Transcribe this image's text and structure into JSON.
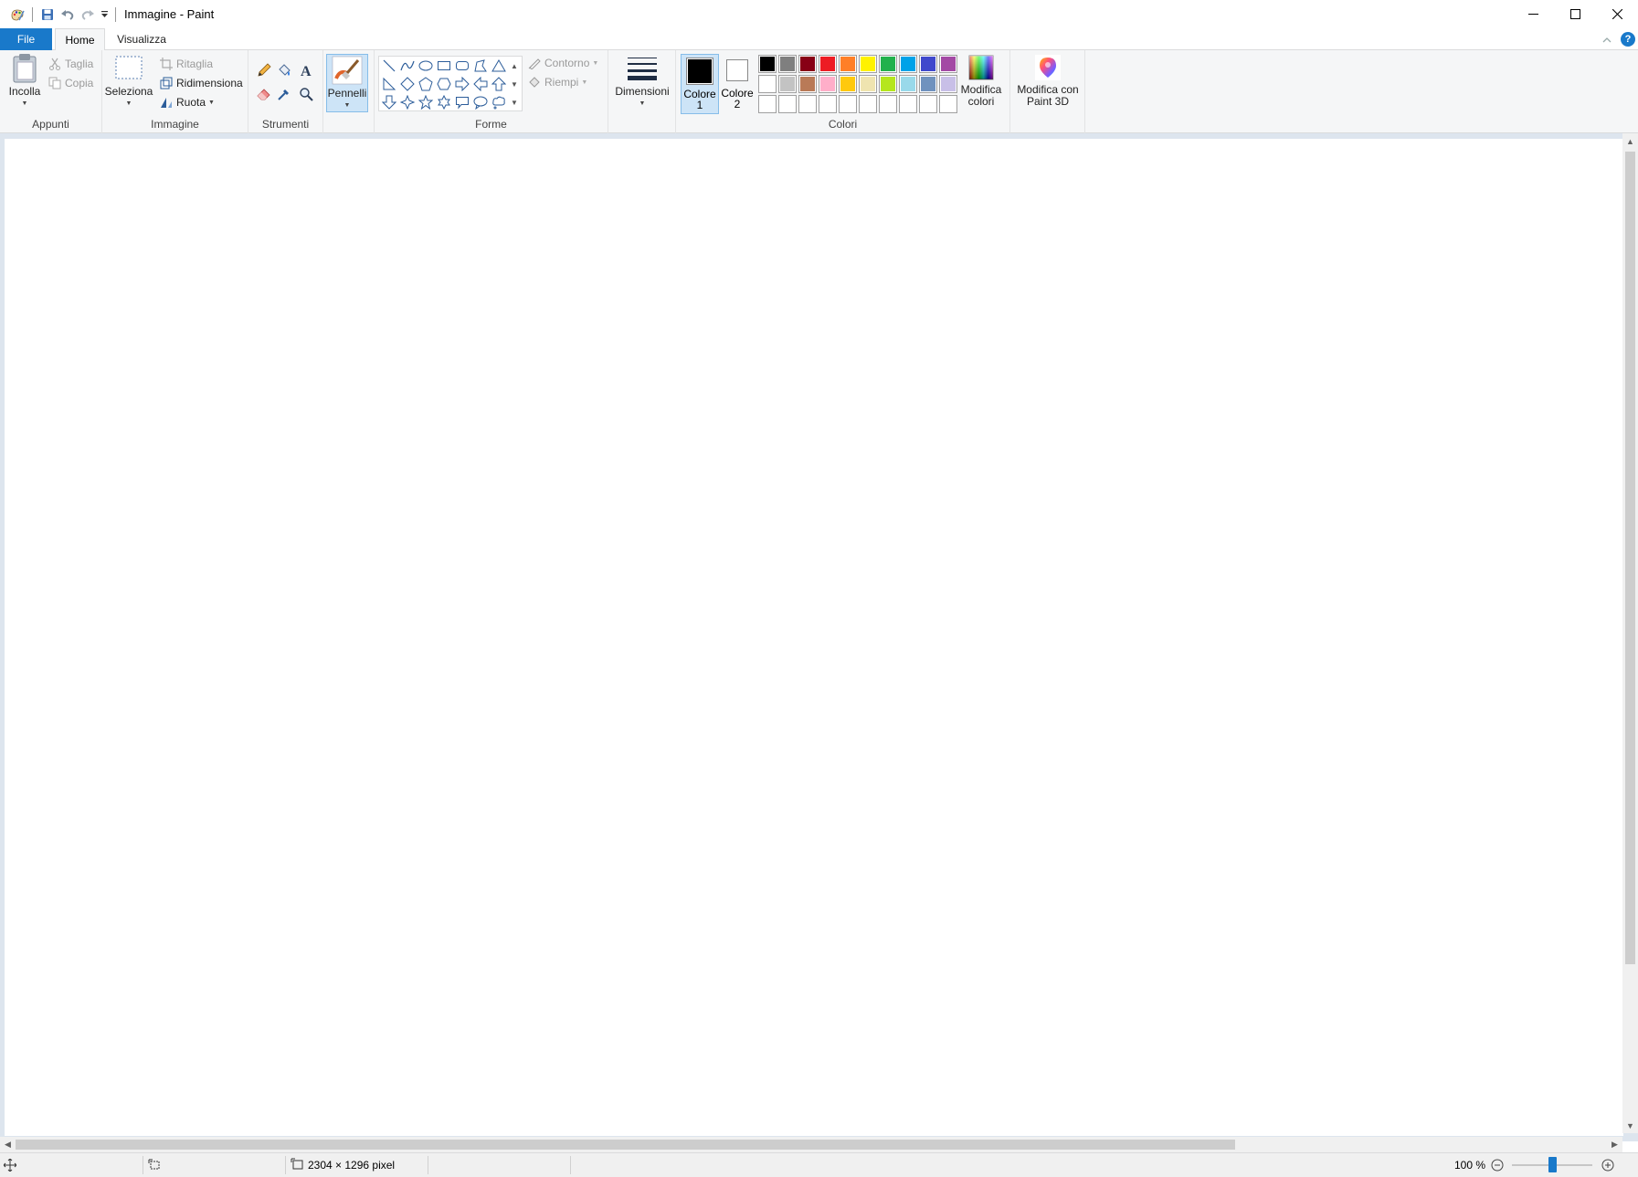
{
  "window": {
    "title": "Immagine - Paint"
  },
  "tabs": {
    "file": "File",
    "home": "Home",
    "view": "Visualizza"
  },
  "ribbon": {
    "clipboard": {
      "label": "Appunti",
      "paste": "Incolla",
      "cut": "Taglia",
      "copy": "Copia"
    },
    "image": {
      "label": "Immagine",
      "select": "Seleziona",
      "crop": "Ritaglia",
      "resize": "Ridimensiona",
      "rotate": "Ruota"
    },
    "tools": {
      "label": "Strumenti"
    },
    "brushes": {
      "label": "Pennelli"
    },
    "shapes": {
      "label": "Forme",
      "outline": "Contorno",
      "fill": "Riempi"
    },
    "size": {
      "label": "Dimensioni"
    },
    "colors": {
      "label": "Colori",
      "color1_line1": "Colore",
      "color1_line2": "1",
      "color2_line1": "Colore",
      "color2_line2": "2",
      "edit_line1": "Modifica",
      "edit_line2": "colori",
      "color1_value": "#000000",
      "color2_value": "#ffffff",
      "palette_row1": [
        "#000000",
        "#7f7f7f",
        "#880015",
        "#ed1c24",
        "#ff7f27",
        "#fff200",
        "#22b14c",
        "#00a2e8",
        "#3f48cc",
        "#a349a4"
      ],
      "palette_row2": [
        "#ffffff",
        "#c3c3c3",
        "#b97a57",
        "#ffaec9",
        "#ffc90e",
        "#efe4b0",
        "#b5e61d",
        "#99d9ea",
        "#7092be",
        "#c8bfe7"
      ]
    },
    "paint3d": {
      "line1": "Modifica con",
      "line2": "Paint 3D"
    }
  },
  "status": {
    "image_size": "2304 × 1296 pixel",
    "zoom": "100 %"
  }
}
